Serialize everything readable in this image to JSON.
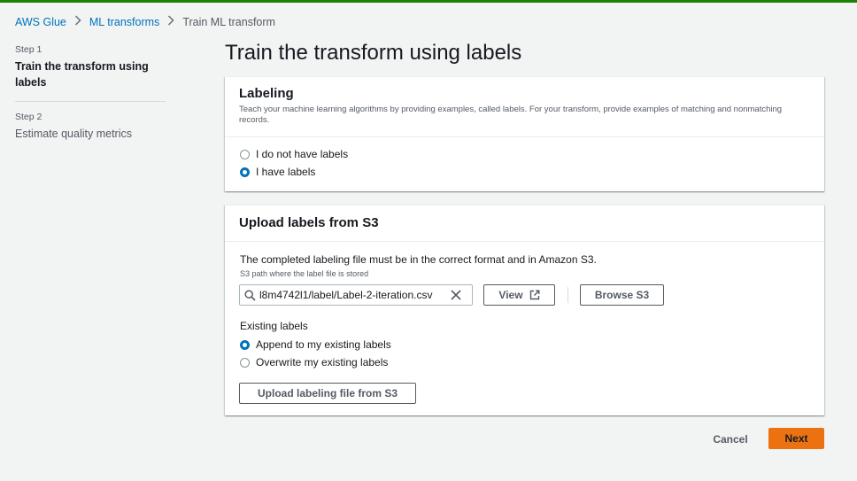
{
  "breadcrumb": {
    "items": [
      "AWS Glue",
      "ML transforms"
    ],
    "current": "Train ML transform"
  },
  "steps": [
    {
      "num": "Step 1",
      "title": "Train the transform using labels",
      "active": true
    },
    {
      "num": "Step 2",
      "title": "Estimate quality metrics",
      "active": false
    }
  ],
  "page": {
    "title": "Train the transform using labels"
  },
  "labeling": {
    "title": "Labeling",
    "description": "Teach your machine learning algorithms by providing examples, called labels. For your transform, provide examples of matching and nonmatching records.",
    "options": [
      {
        "label": "I do not have labels",
        "checked": false
      },
      {
        "label": "I have labels",
        "checked": true
      }
    ]
  },
  "upload": {
    "title": "Upload labels from S3",
    "intro": "The completed labeling file must be in the correct format and in Amazon S3.",
    "hint": "S3 path where the label file is stored",
    "s3_path": "l8m4742l1/label/Label-2-iteration.csv",
    "view_label": "View",
    "browse_label": "Browse S3",
    "existing_title": "Existing labels",
    "existing_options": [
      {
        "label": "Append to my existing labels",
        "checked": true
      },
      {
        "label": "Overwrite my existing labels",
        "checked": false
      }
    ],
    "upload_button": "Upload labeling file from S3"
  },
  "footer": {
    "cancel": "Cancel",
    "next": "Next"
  },
  "colors": {
    "accent": "#0073bb",
    "primary_button": "#ec7211",
    "success_bar": "#1d8102"
  },
  "icons": [
    "chevron-right-icon",
    "search-icon",
    "clear-icon",
    "external-link-icon"
  ]
}
